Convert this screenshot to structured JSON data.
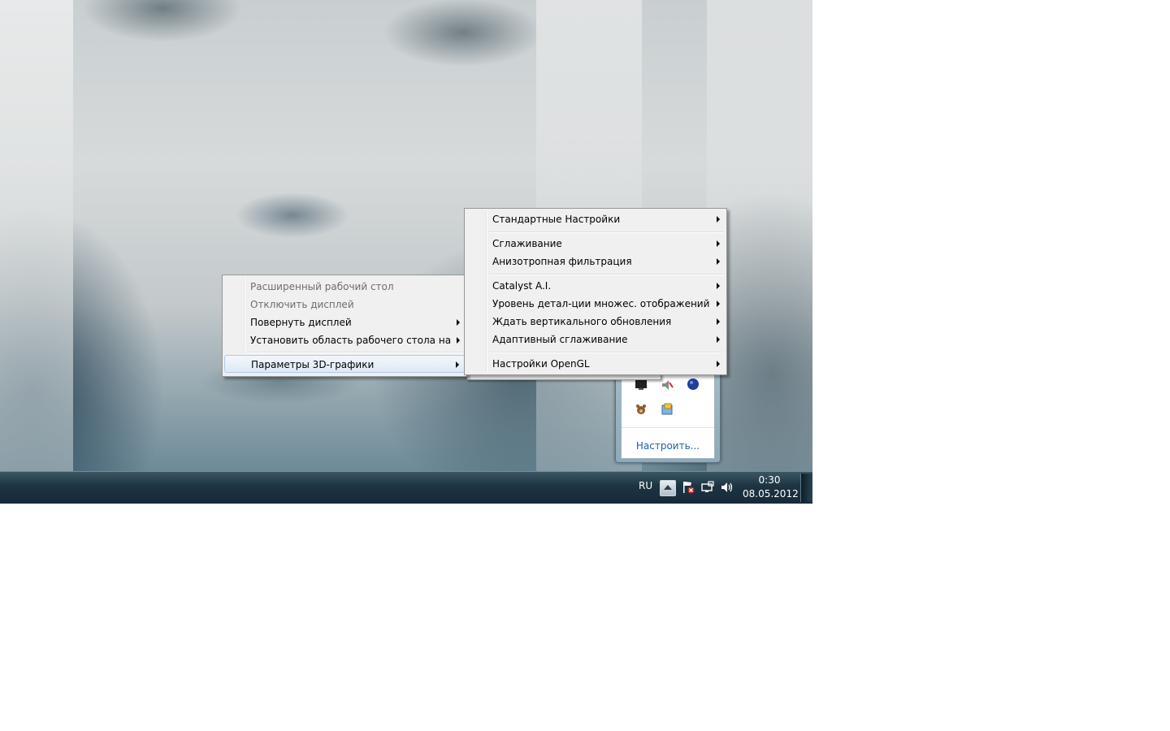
{
  "context_menu": {
    "items": [
      {
        "label": "Расширенный рабочий стол"
      },
      {
        "label": "Отключить дисплей"
      },
      {
        "label": "Повернуть дисплей"
      },
      {
        "label": "Установить область рабочего стола на"
      },
      {
        "label": "Параметры 3D-графики"
      }
    ]
  },
  "submenu_3d": {
    "items": [
      {
        "label": "Стандартные Настройки"
      },
      {
        "label": "Сглаживание"
      },
      {
        "label": "Анизотропная фильтрация"
      },
      {
        "label": "Catalyst A.I."
      },
      {
        "label": "Уровень детал-ции множес. отображений"
      },
      {
        "label": "Ждать вертикального обновления"
      },
      {
        "label": "Адаптивный сглаживание"
      },
      {
        "label": "Настройки OpenGL"
      }
    ]
  },
  "tray_overflow": {
    "customize_label": "Настроить..."
  },
  "taskbar": {
    "language": "RU",
    "time": "0:30",
    "date": "08.05.2012"
  },
  "colors": {
    "menu_bg": "#f0f0f0",
    "highlight_border": "#aecbe8",
    "link_blue": "#1e5fa8",
    "taskbar": "#1d3442"
  }
}
